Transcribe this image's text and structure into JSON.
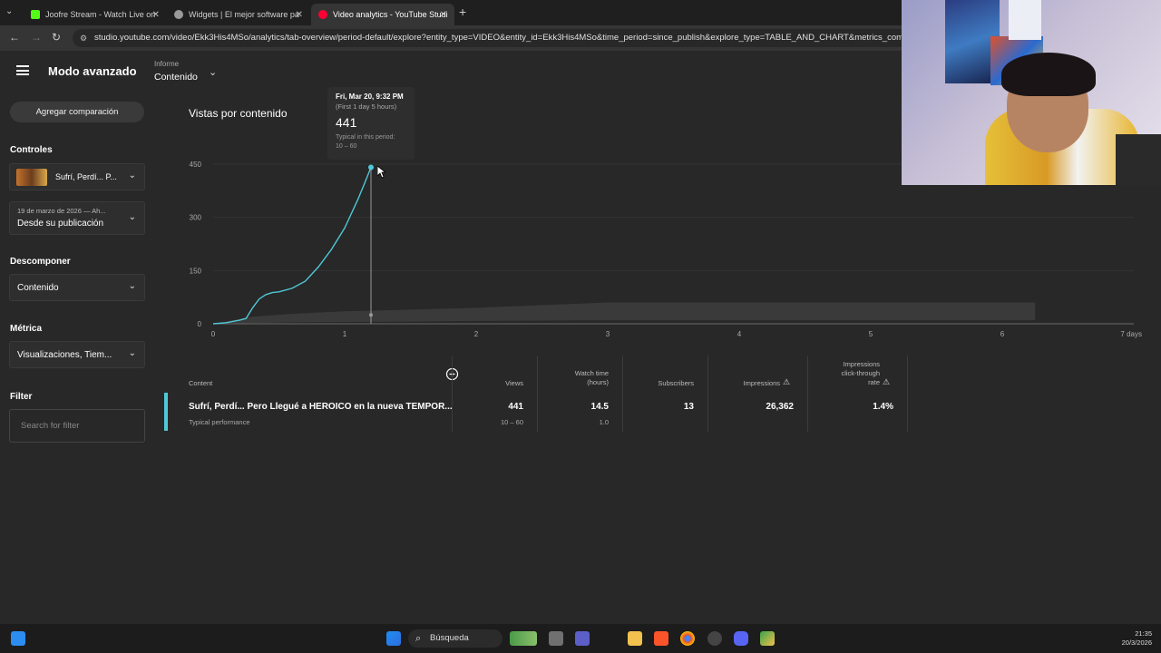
{
  "browser": {
    "tabs": [
      {
        "title": "Joofre Stream - Watch Live on",
        "color": "#53fc18",
        "active": false
      },
      {
        "title": "Widgets | El mejor software pa",
        "color": "#9a9a9a",
        "active": false
      },
      {
        "title": "Video analytics - YouTube Studi",
        "color": "#ff0033",
        "active": true
      }
    ],
    "url": "studio.youtube.com/video/Ekk3His4MSo/analytics/tab-overview/period-default/explore?entity_type=VIDEO&entity_id=Ekk3His4MSo&time_period=since_publish&explore_type=TABLE_AND_CHART&metrics_computa"
  },
  "header": {
    "title": "Modo avanzado",
    "report_label": "Informe",
    "report_value": "Contenido"
  },
  "sidebar": {
    "compare_button": "Agregar comparación",
    "controls_label": "Controles",
    "video_select": "Sufrí, Perdí... P...",
    "date_top": "19 de marzo de 2026 — Ah...",
    "date_value": "Desde su publicación",
    "breakdown_label": "Descomponer",
    "breakdown_value": "Contenido",
    "metric_label": "Métrica",
    "metric_value": "Visualizaciones, Tiem...",
    "filter_label": "Filter",
    "filter_placeholder": "Search for filter"
  },
  "chart": {
    "title": "Vistas por contenido",
    "accent": "#4ec9d8"
  },
  "tooltip": {
    "date": "Fri, Mar 20, 9:32 PM",
    "sub": "(First 1 day 5 hours)",
    "value": "441",
    "typical_label": "Typical in this period:",
    "typical_range": "10 – 60"
  },
  "chart_data": {
    "type": "line",
    "title": "Vistas por contenido",
    "xlabel": "",
    "ylabel": "",
    "x_ticks": [
      "0",
      "1",
      "2",
      "3",
      "4",
      "5",
      "6",
      "7 days"
    ],
    "y_ticks": [
      "0",
      "150",
      "300",
      "450"
    ],
    "xlim": [
      0,
      7
    ],
    "ylim": [
      0,
      450
    ],
    "series": [
      {
        "x": [
          0,
          0.1,
          0.2,
          0.25,
          0.3,
          0.35,
          0.4,
          0.45,
          0.5,
          0.6,
          0.7,
          0.8,
          0.9,
          1.0,
          1.1,
          1.15,
          1.2
        ],
        "y": [
          0,
          3,
          10,
          15,
          45,
          70,
          82,
          88,
          90,
          100,
          120,
          160,
          210,
          270,
          350,
          395,
          441
        ]
      }
    ],
    "typical_band": {
      "x": [
        0,
        0.3,
        0.6,
        1.0,
        1.5,
        2.0,
        3.0,
        4.0,
        5.0,
        6.0,
        6.25
      ],
      "low": [
        0,
        2,
        4,
        5,
        6,
        8,
        10,
        10,
        10,
        10,
        10
      ],
      "high": [
        0,
        20,
        28,
        35,
        40,
        45,
        60,
        60,
        60,
        60,
        60
      ]
    }
  },
  "table": {
    "headers": {
      "content": "Content",
      "views": "Views",
      "watch_time": [
        "Watch time",
        "(hours)"
      ],
      "subscribers": "Subscribers",
      "impressions": "Impressions",
      "ctr": [
        "Impressions",
        "click-through",
        "rate"
      ]
    },
    "row": {
      "title": "Sufrí, Perdí... Pero Llegué a HEROICO en la nueva TEMPOR...",
      "subtitle": "Typical performance",
      "views": "441",
      "views_typical": "10 – 60",
      "watch_time": "14.5",
      "watch_time_typical": "1.0",
      "subscribers": "13",
      "impressions": "26,362",
      "ctr": "1.4%"
    }
  },
  "taskbar": {
    "search": "Búsqueda",
    "time": "21:35",
    "date": "20/3/2026"
  }
}
